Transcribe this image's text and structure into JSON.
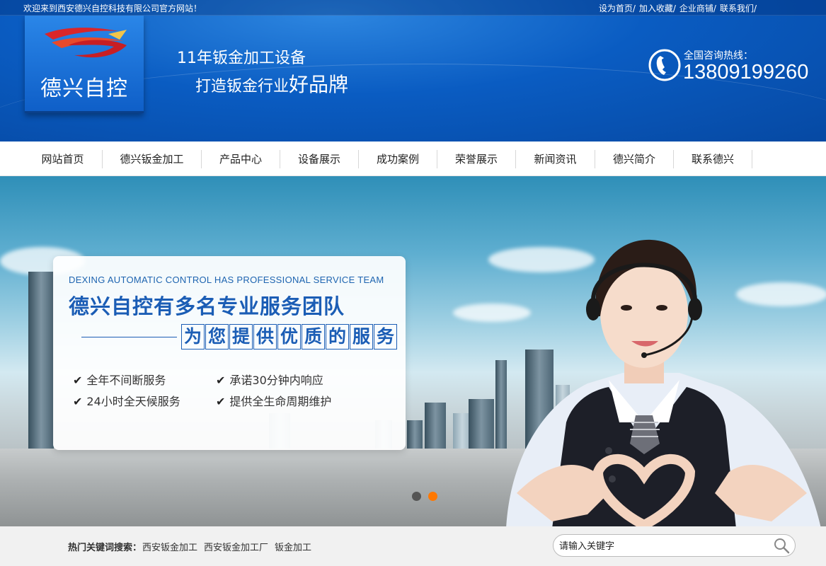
{
  "topbar": {
    "welcome": "欢迎来到西安德兴自控科技有限公司官方网站！",
    "links": [
      "设为首页/",
      "加入收藏/",
      "企业商铺/",
      "联系我们/"
    ]
  },
  "logo": {
    "text": "德兴自控",
    "icon": "swoosh-logo-icon"
  },
  "slogan": {
    "line1": "11年钣金加工设备",
    "line2_prefix": "打造钣金行业",
    "line2_emphasis": "好品牌"
  },
  "hotline": {
    "label": "全国咨询热线：",
    "number": "13809199260",
    "icon": "phone-icon"
  },
  "nav": {
    "items": [
      "网站首页",
      "德兴钣金加工",
      "产品中心",
      "设备展示",
      "成功案例",
      "荣誉展示",
      "新闻资讯",
      "德兴简介",
      "联系德兴"
    ]
  },
  "banner": {
    "en_title": "DEXING AUTOMATIC CONTROL HAS PROFESSIONAL SERVICE TEAM",
    "title": "德兴自控有多名专业服务团队",
    "subtitle_chars": [
      "为",
      "您",
      "提",
      "供",
      "优",
      "质",
      "的",
      "服",
      "务"
    ],
    "features": [
      "全年不间断服务",
      "承诺30分钟内响应",
      "24小时全天候服务",
      "提供全生命周期维护"
    ],
    "slides": 2,
    "active_slide": 2,
    "colors": {
      "dot_inactive": "#555555",
      "dot_active": "#ff7800"
    }
  },
  "search": {
    "hot_label": "热门关键词搜索：",
    "hot_keywords": [
      "西安钣金加工",
      "西安钣金加工厂",
      "钣金加工"
    ],
    "placeholder": "请输入关键字",
    "icon": "search-icon"
  },
  "colors": {
    "header_blue": "#0a5cc2",
    "title_blue": "#1b5db5",
    "accent_orange": "#ff7800"
  }
}
